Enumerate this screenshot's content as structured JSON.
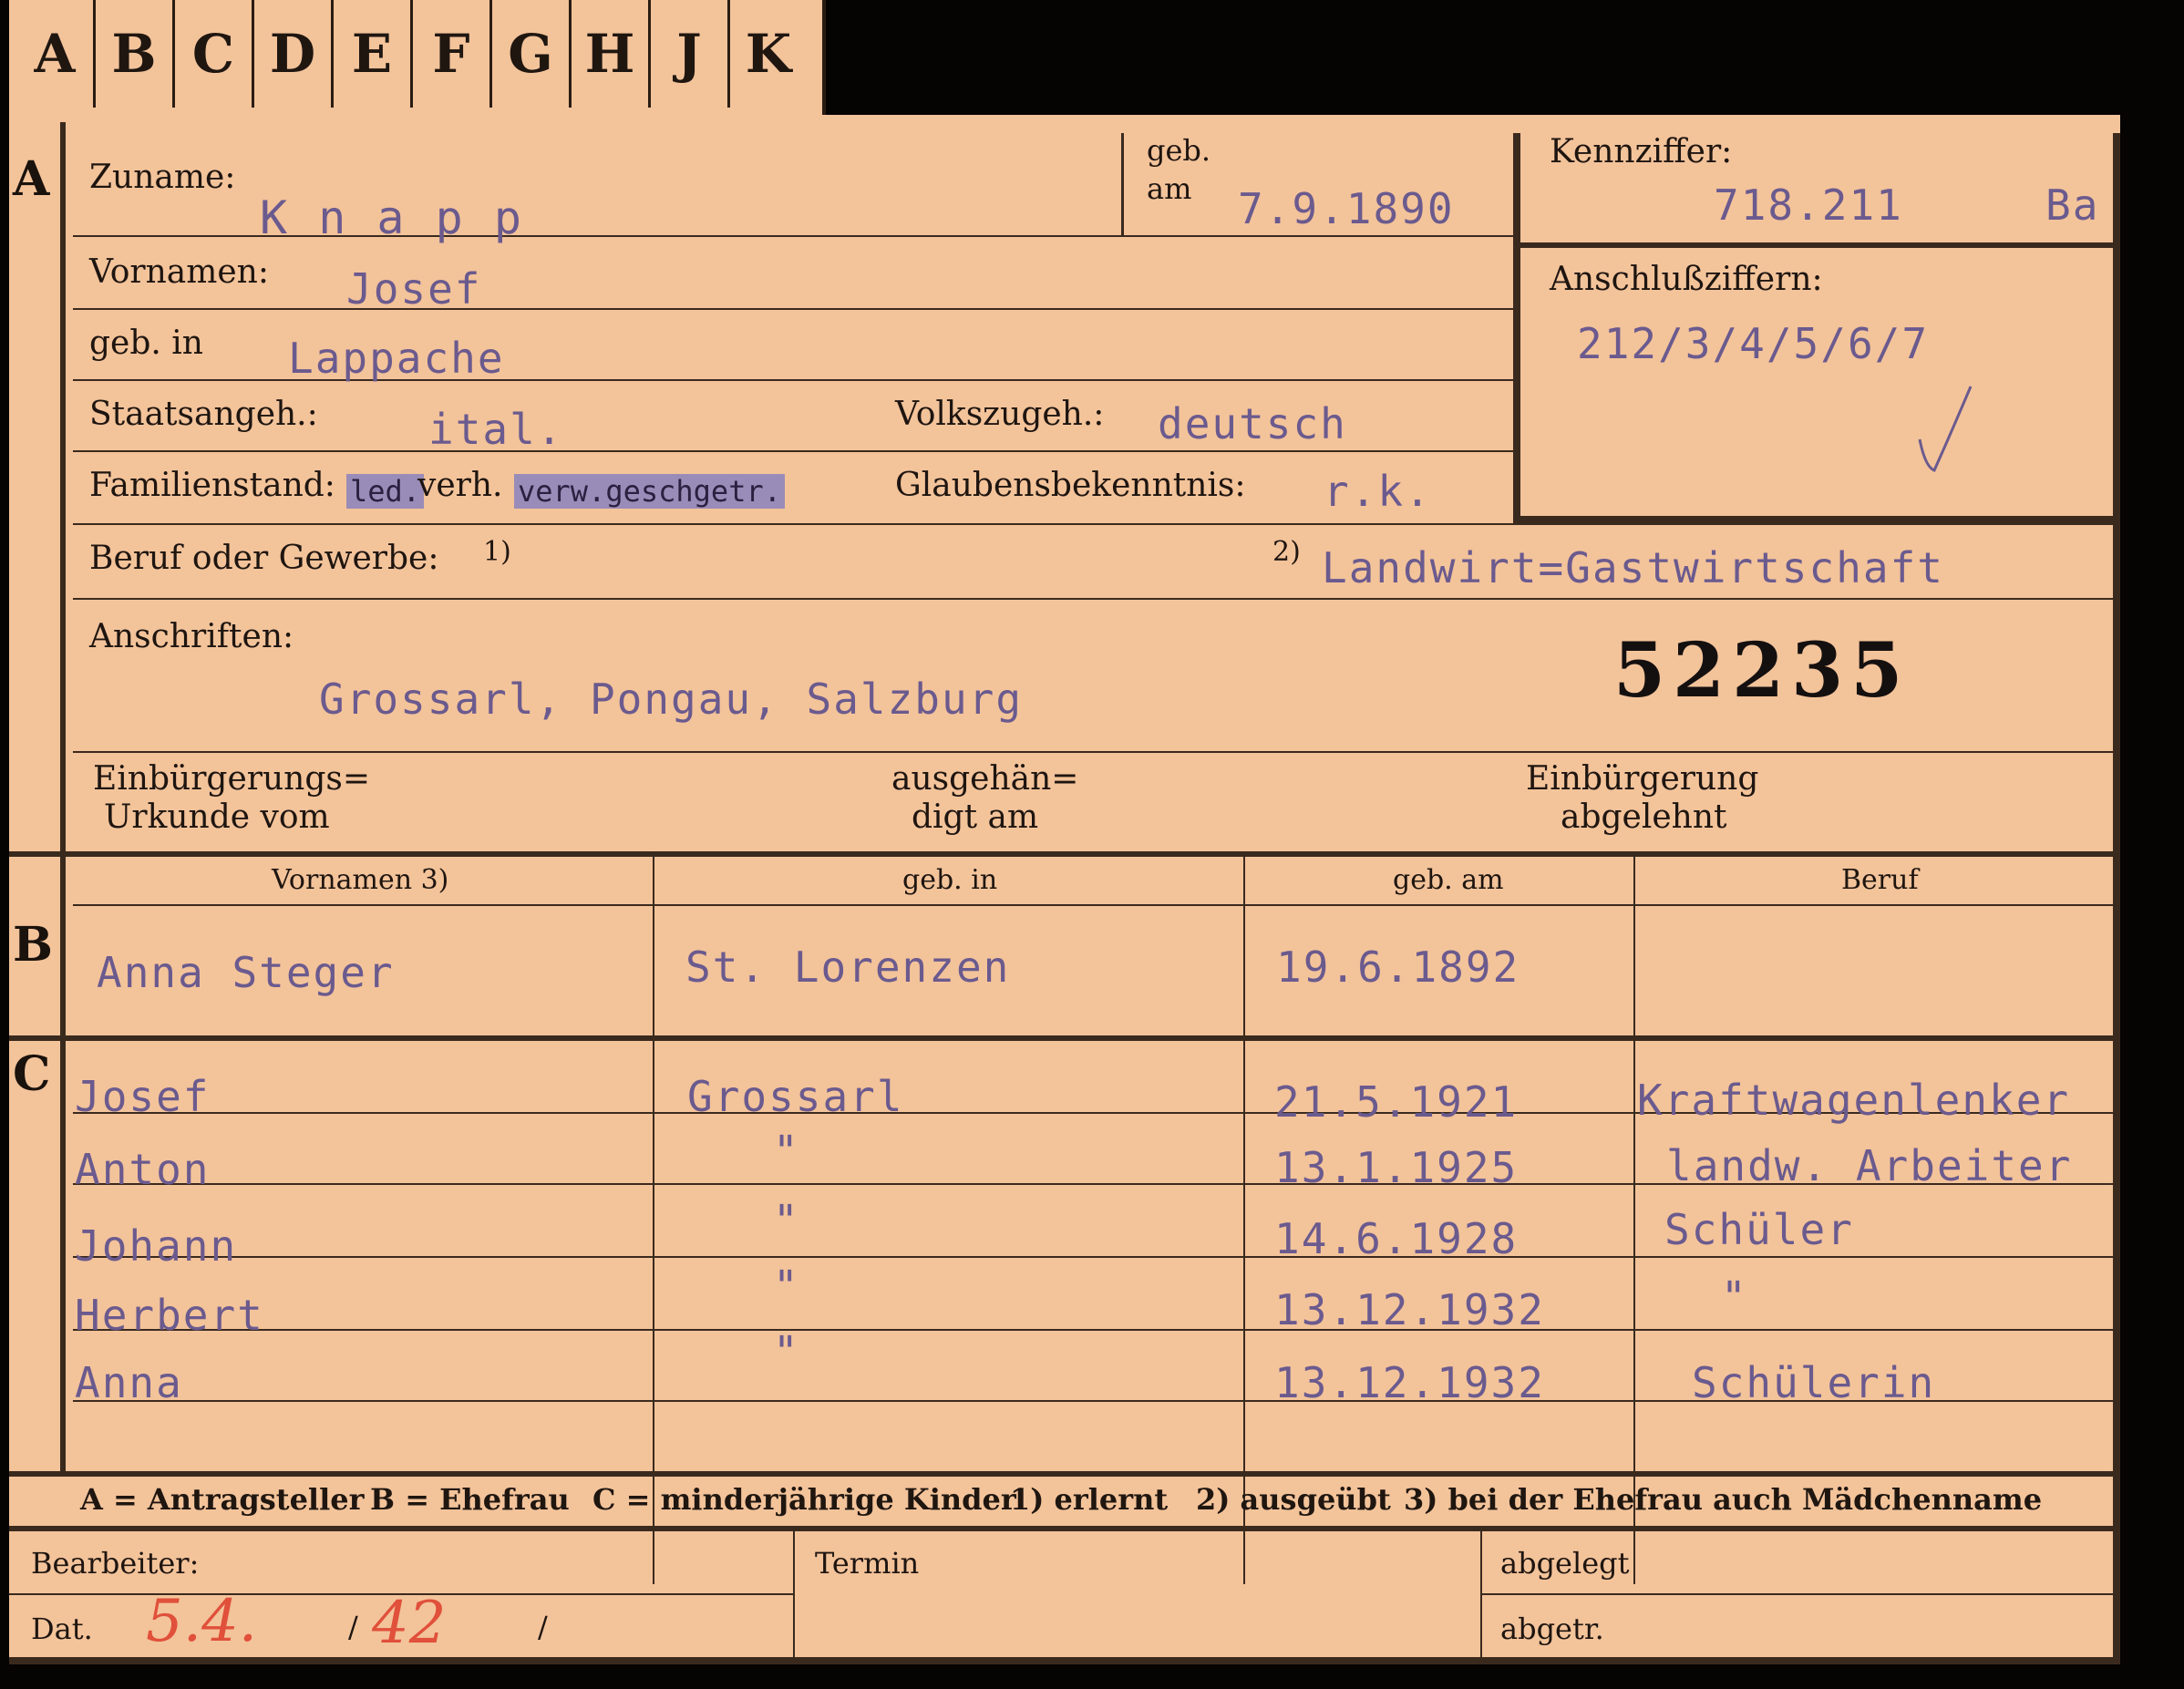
{
  "tabs": [
    "A",
    "B",
    "C",
    "D",
    "E",
    "F",
    "G",
    "H",
    "J",
    "K"
  ],
  "sections": {
    "a": "A",
    "b": "B",
    "c": "C"
  },
  "labels": {
    "zuname": "Zuname:",
    "geb": "geb.",
    "am": "am",
    "kennziffer": "Kennziffer:",
    "vornamen": "Vornamen:",
    "anschluss": "Anschlußziffern:",
    "geb_in": "geb. in",
    "staats": "Staatsangeh.:",
    "volks": "Volkszugeh.:",
    "familien": "Familienstand:",
    "familien_opt_ledig": "led.",
    "familien_opt_verh": "verh.",
    "familien_opt_rest": "verw.geschgetr.",
    "glaubens": "Glaubensbekenntnis:",
    "beruf": "Beruf oder Gewerbe:",
    "beruf_fn1": "1)",
    "beruf_fn2": "2)",
    "anschriften": "Anschriften:",
    "einb_urk_1": "Einbürgerungs=",
    "einb_urk_2": "Urkunde vom",
    "ausgeh_1": "ausgehän=",
    "ausgeh_2": "digt am",
    "einb_abg_1": "Einbürgerung",
    "einb_abg_2": "abgelehnt"
  },
  "person": {
    "zuname": "K n a p p",
    "geb_am": "7.9.1890",
    "kennziffer": "718.211",
    "kennziffer_suffix": "Ba",
    "vornamen": "Josef",
    "anschlussziffern": "212/3/4/5/6/7",
    "geb_in": "Lappache",
    "staatsangeh": "ital.",
    "volkszugeh": "deutsch",
    "glaubens": "r.k.",
    "beruf_ausgeuebt": "Landwirt=Gastwirtschaft",
    "anschrift": "Grossarl, Pongau, Salzburg",
    "aktennummer": "52235"
  },
  "spouse_table": {
    "headers": [
      "Vornamen 3)",
      "geb. in",
      "geb. am",
      "Beruf"
    ],
    "row": [
      "Anna Steger",
      "St. Lorenzen",
      "19.6.1892",
      ""
    ]
  },
  "children": [
    {
      "name": "Josef",
      "place": "Grossarl",
      "date": "21.5.1921",
      "job": "Kraftwagenlenker"
    },
    {
      "name": "Anton",
      "place": "\"",
      "date": "13.1.1925",
      "job": "landw. Arbeiter"
    },
    {
      "name": "Johann",
      "place": "\"",
      "date": "14.6.1928",
      "job": "Schüler"
    },
    {
      "name": "Herbert",
      "place": "\"",
      "date": "13.12.1932",
      "job": "\""
    },
    {
      "name": "Anna",
      "place": "\"",
      "date": "13.12.1932",
      "job": "Schülerin"
    }
  ],
  "legend": {
    "a": "A = Antragsteller",
    "b": "B = Ehefrau",
    "c": "C = minderjährige Kinder",
    "fn1": "1) erlernt",
    "fn2": "2) ausgeübt",
    "fn3": "3) bei der Ehefrau auch Mädchenname"
  },
  "footer": {
    "bearbeiter": "Bearbeiter:",
    "dat": "Dat.",
    "dat_value": "5.4.",
    "dat_year": "42",
    "slash1": "/",
    "slash2": "/",
    "termin": "Termin",
    "abgelegt": "abgelegt",
    "abgetr": "abgetr."
  },
  "colors": {
    "card": "#f3c39a",
    "ink_typewriter": "#6a5a8e",
    "ink_print": "#1e1510",
    "pencil_red": "#e0503a",
    "background": "#050403"
  }
}
